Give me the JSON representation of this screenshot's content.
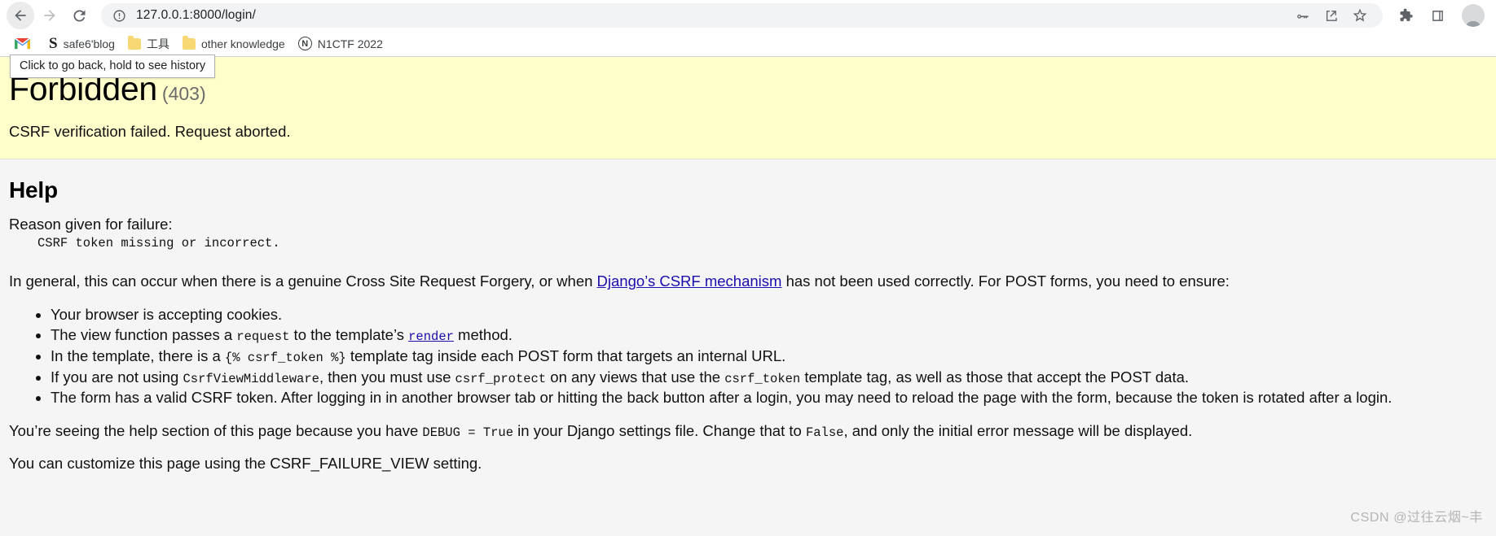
{
  "browser": {
    "nav": {
      "back_label": "back-arrow",
      "forward_label": "forward-arrow",
      "reload_label": "reload"
    },
    "tooltip": "Click to go back, hold to see history",
    "omnibox": {
      "url": "127.0.0.1:8000/login/",
      "site_info_icon": "info-circle-icon",
      "icons": [
        "key-icon",
        "share-icon",
        "star-icon"
      ]
    },
    "chrome_icons": [
      "extensions-puzzle-icon",
      "side-panel-icon",
      "profile-avatar"
    ],
    "bookmarks": [
      {
        "icon": "gmail-icon",
        "label": ""
      },
      {
        "icon": "s-letter-icon",
        "label": "safe6'blog"
      },
      {
        "icon": "folder-icon",
        "label": "工具"
      },
      {
        "icon": "folder-icon",
        "label": "other knowledge"
      },
      {
        "icon": "n-circle-icon",
        "label": "N1CTF 2022"
      }
    ]
  },
  "page": {
    "title": "Forbidden",
    "status_code": "(403)",
    "exception": "CSRF verification failed. Request aborted.",
    "help_heading": "Help",
    "reason_label": "Reason given for failure:",
    "reason_value": "CSRF token missing or incorrect.",
    "general": {
      "before_link": "In general, this can occur when there is a genuine Cross Site Request Forgery, or when ",
      "link_text": "Django’s CSRF mechanism",
      "after_link": " has not been used correctly. For POST forms, you need to ensure:"
    },
    "bullets": [
      {
        "parts": [
          {
            "type": "text",
            "value": "Your browser is accepting cookies."
          }
        ]
      },
      {
        "parts": [
          {
            "type": "text",
            "value": "The view function passes a "
          },
          {
            "type": "code",
            "value": "request"
          },
          {
            "type": "text",
            "value": " to the template’s "
          },
          {
            "type": "link-code",
            "value": "render"
          },
          {
            "type": "text",
            "value": " method."
          }
        ]
      },
      {
        "parts": [
          {
            "type": "text",
            "value": "In the template, there is a "
          },
          {
            "type": "code",
            "value": "{% csrf_token %}"
          },
          {
            "type": "text",
            "value": " template tag inside each POST form that targets an internal URL."
          }
        ]
      },
      {
        "parts": [
          {
            "type": "text",
            "value": "If you are not using "
          },
          {
            "type": "code",
            "value": "CsrfViewMiddleware"
          },
          {
            "type": "text",
            "value": ", then you must use "
          },
          {
            "type": "code",
            "value": "csrf_protect"
          },
          {
            "type": "text",
            "value": " on any views that use the "
          },
          {
            "type": "code",
            "value": "csrf_token"
          },
          {
            "type": "text",
            "value": " template tag, as well as those that accept the POST data."
          }
        ]
      },
      {
        "parts": [
          {
            "type": "text",
            "value": "The form has a valid CSRF token. After logging in in another browser tab or hitting the back button after a login, you may need to reload the page with the form, because the token is rotated after a login."
          }
        ]
      }
    ],
    "debug_note": {
      "before": "You’re seeing the help section of this page because you have ",
      "code1": "DEBUG = True",
      "middle": " in your Django settings file. Change that to ",
      "code2": "False",
      "after": ", and only the initial error message will be displayed."
    },
    "customize_note": {
      "before": "You can customize this page using the ",
      "setting": "CSRF_FAILURE_VIEW",
      "after": " setting."
    }
  },
  "watermark": "CSDN @过往云烟~丰",
  "colors": {
    "summary_bg": "#ffffcc",
    "page_bg": "#f5f5f5",
    "link": "#1a0dab",
    "status_code": "#6b6b6b"
  }
}
